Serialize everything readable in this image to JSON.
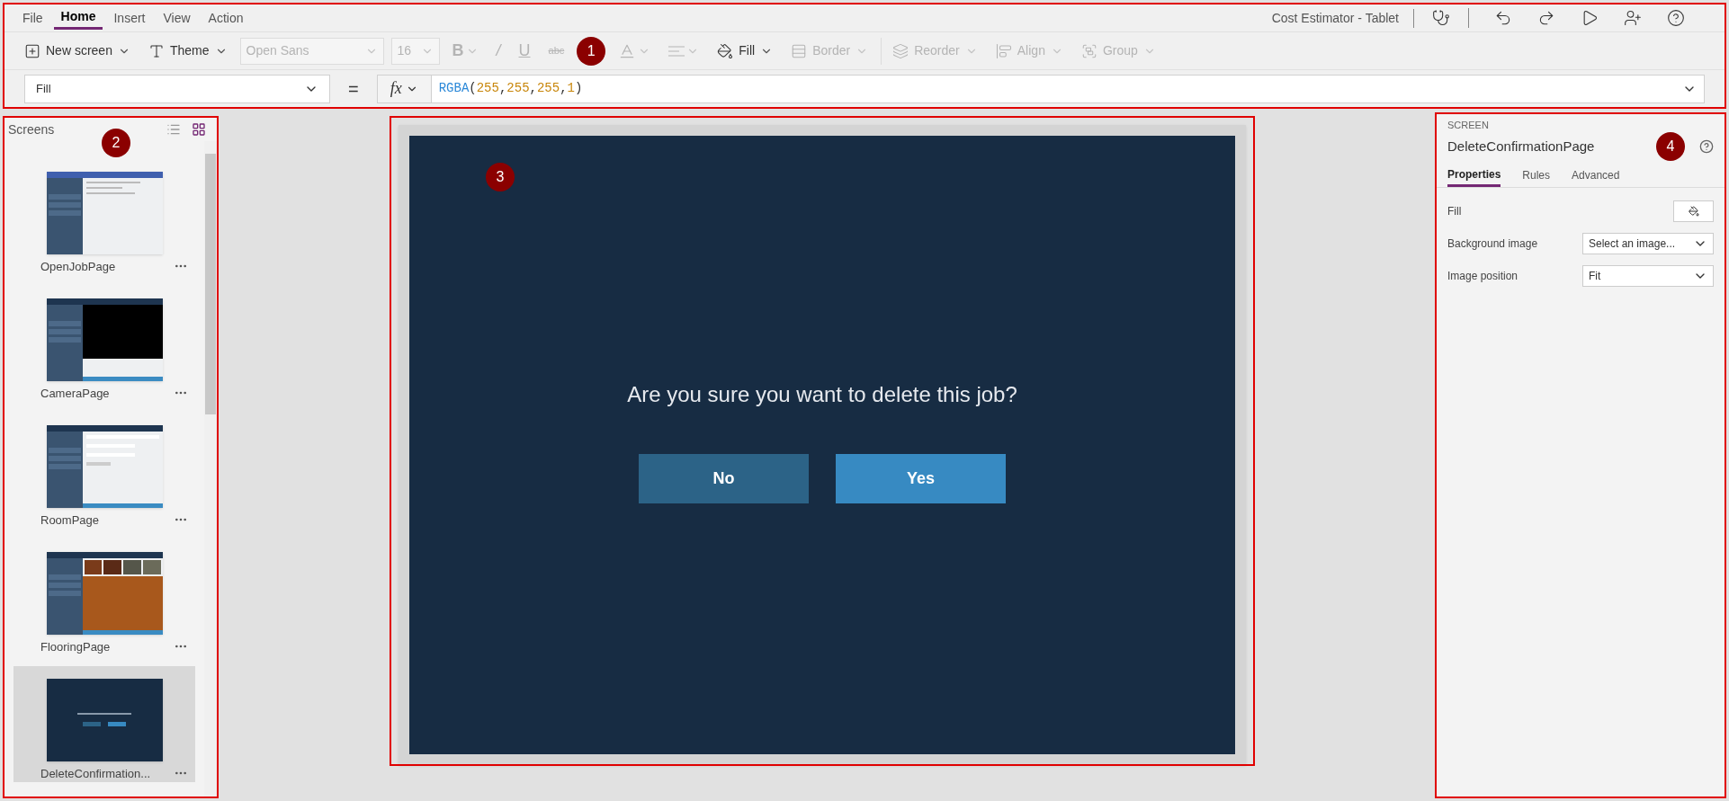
{
  "menu": [
    {
      "label": "File",
      "selected": false
    },
    {
      "label": "Home",
      "selected": true
    },
    {
      "label": "Insert",
      "selected": false
    },
    {
      "label": "View",
      "selected": false
    },
    {
      "label": "Action",
      "selected": false
    }
  ],
  "app_title": "Cost Estimator - Tablet",
  "toolbar": [
    {
      "kind": "button",
      "label": "New screen",
      "disabled": false,
      "dropdown": true
    },
    {
      "kind": "button",
      "label": "Theme",
      "disabled": false,
      "dropdown": true
    },
    {
      "kind": "select",
      "value": "Open Sans",
      "disabled": true
    },
    {
      "kind": "select",
      "value": "16",
      "disabled": true
    },
    {
      "kind": "text",
      "label": "B",
      "disabled": true,
      "dropdown": true
    },
    {
      "kind": "text",
      "label": "/",
      "disabled": true,
      "dropdown": false
    },
    {
      "kind": "text",
      "label": "U",
      "disabled": true,
      "dropdown": false
    },
    {
      "kind": "text",
      "label": "abc",
      "disabled": true,
      "dropdown": false
    },
    {
      "kind": "icon",
      "disabled": true,
      "dropdown": true
    },
    {
      "kind": "icon",
      "disabled": true,
      "dropdown": true
    },
    {
      "kind": "button",
      "label": "Fill",
      "disabled": false,
      "dropdown": true
    },
    {
      "kind": "button",
      "label": "Border",
      "disabled": true,
      "dropdown": true
    },
    {
      "kind": "button",
      "label": "Reorder",
      "disabled": true,
      "dropdown": true
    },
    {
      "kind": "button",
      "label": "Align",
      "disabled": true,
      "dropdown": true
    },
    {
      "kind": "button",
      "label": "Group",
      "disabled": true,
      "dropdown": true
    }
  ],
  "formula_bar": {
    "property": "Fill",
    "equals": "=",
    "fx": "fx",
    "tokens": [
      {
        "kind": "function",
        "text": "RGBA"
      },
      {
        "kind": "punct",
        "text": "("
      },
      {
        "kind": "number",
        "text": "255"
      },
      {
        "kind": "punct",
        "text": ","
      },
      {
        "kind": "number",
        "text": "255"
      },
      {
        "kind": "punct",
        "text": ","
      },
      {
        "kind": "number",
        "text": "255"
      },
      {
        "kind": "punct",
        "text": ","
      },
      {
        "kind": "number",
        "text": "1"
      },
      {
        "kind": "punct",
        "text": ")"
      }
    ]
  },
  "screens_panel": {
    "title": "Screens",
    "view_toggles": [
      {
        "selected": false
      },
      {
        "selected": true
      }
    ],
    "screens": [
      {
        "name": "OpenJobPage",
        "kind": "list",
        "selected": false
      },
      {
        "name": "CameraPage",
        "kind": "camera",
        "selected": false
      },
      {
        "name": "RoomPage",
        "kind": "form",
        "selected": false
      },
      {
        "name": "FlooringPage",
        "kind": "gallery",
        "selected": false
      },
      {
        "name": "DeleteConfirmation...",
        "kind": "dialog",
        "selected": true
      }
    ]
  },
  "canvas": {
    "message": "Are you sure you want to delete this job?",
    "buttons": [
      {
        "label": "No",
        "kind": "secondary"
      },
      {
        "label": "Yes",
        "kind": "primary"
      }
    ]
  },
  "properties_panel": {
    "type": "SCREEN",
    "name": "DeleteConfirmationPage",
    "tabs": [
      {
        "label": "Properties",
        "selected": true
      },
      {
        "label": "Rules",
        "selected": false
      },
      {
        "label": "Advanced",
        "selected": false
      }
    ],
    "properties": [
      {
        "kind": "color",
        "label": "Fill"
      },
      {
        "kind": "select",
        "label": "Background image",
        "value": "Select an image..."
      },
      {
        "kind": "select",
        "label": "Image position",
        "value": "Fit"
      }
    ]
  },
  "callouts": [
    "1",
    "2",
    "3",
    "4"
  ]
}
